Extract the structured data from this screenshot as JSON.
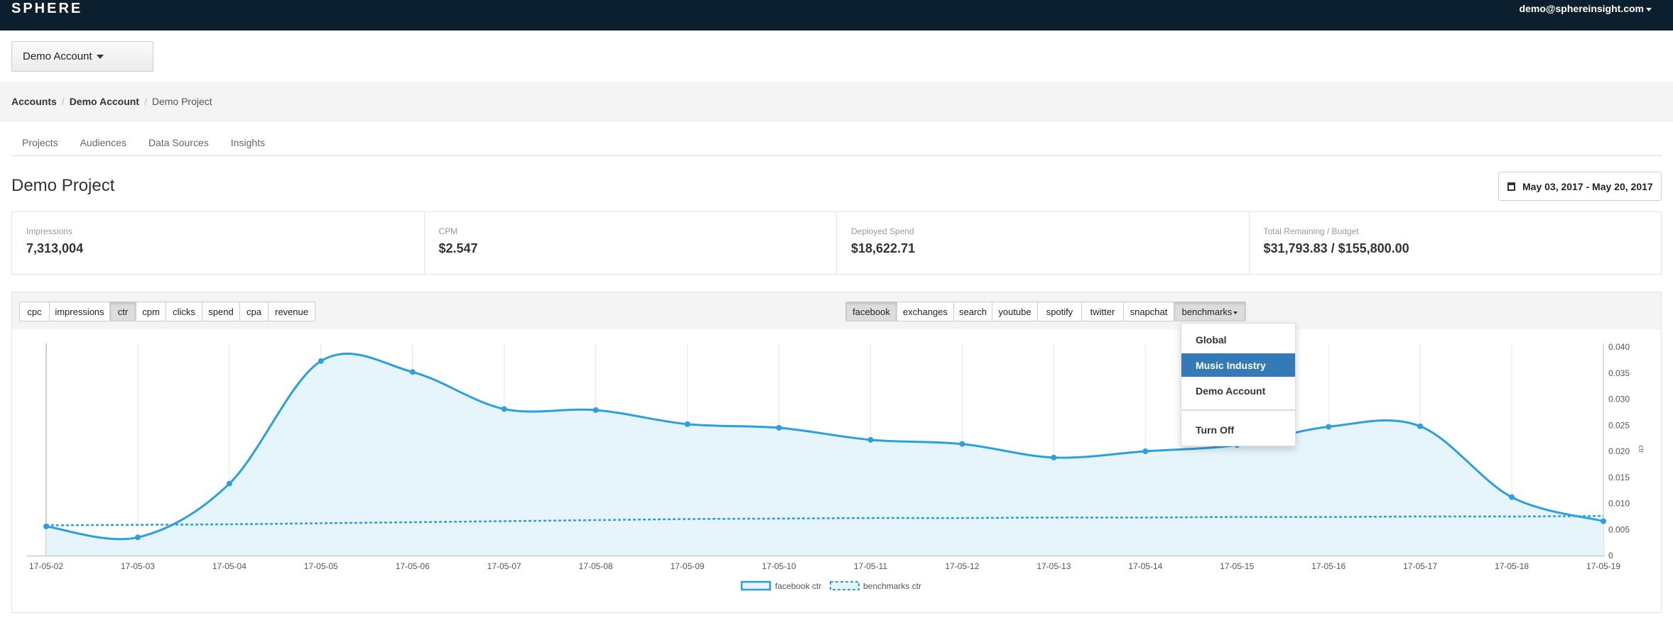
{
  "header": {
    "brand": "SPHERE",
    "user_email": "demo@sphereinsight.com"
  },
  "account": {
    "label": "Demo Account"
  },
  "breadcrumb": [
    "Accounts",
    "Demo Account",
    "Demo Project"
  ],
  "nav": [
    "Projects",
    "Audiences",
    "Data Sources",
    "Insights"
  ],
  "page": {
    "title": "Demo Project",
    "date_range": "May 03, 2017 - May 20, 2017"
  },
  "stats": [
    {
      "label": "Impressions",
      "value": "7,313,004"
    },
    {
      "label": "CPM",
      "value": "$2.547"
    },
    {
      "label": "Deployed Spend",
      "value": "$18,622.71"
    },
    {
      "label": "Total Remaining / Budget",
      "value": "$31,793.83 / $155,800.00"
    }
  ],
  "metrics": {
    "items": [
      "cpc",
      "impressions",
      "ctr",
      "cpm",
      "clicks",
      "spend",
      "cpa",
      "revenue"
    ],
    "active": "ctr"
  },
  "channels": {
    "items": [
      "facebook",
      "exchanges",
      "search",
      "youtube",
      "spotify",
      "twitter",
      "snapchat"
    ],
    "active": "facebook",
    "dropdown_label": "benchmarks"
  },
  "benchmark_menu": {
    "items": [
      "Global",
      "Music Industry",
      "Demo Account",
      "Turn Off"
    ],
    "selected": "Music Industry"
  },
  "colors": {
    "topbar": "#0c1f2e",
    "series": "#2b9fe0",
    "area": "#e6f4fc",
    "menu_selected": "#337ab7"
  },
  "chart_data": {
    "type": "area",
    "x": [
      "17-05-02",
      "17-05-03",
      "17-05-04",
      "17-05-05",
      "17-05-06",
      "17-05-07",
      "17-05-08",
      "17-05-09",
      "17-05-10",
      "17-05-11",
      "17-05-12",
      "17-05-13",
      "17-05-14",
      "17-05-15",
      "17-05-16",
      "17-05-17",
      "17-05-18",
      "17-05-19"
    ],
    "series": [
      {
        "name": "facebook ctr",
        "style": "solid-area",
        "values": [
          0.0056,
          0.0035,
          0.0138,
          0.0373,
          0.0352,
          0.0281,
          0.0279,
          0.0252,
          0.0245,
          0.0222,
          0.0214,
          0.0188,
          0.02,
          0.0212,
          0.0247,
          0.0248,
          0.0112,
          0.0066
        ]
      },
      {
        "name": "benchmarks ctr",
        "style": "dashed",
        "values": [
          0.0058,
          0.0059,
          0.006,
          0.0062,
          0.0064,
          0.0066,
          0.0068,
          0.007,
          0.0071,
          0.0072,
          0.0072,
          0.0073,
          0.0073,
          0.0074,
          0.0074,
          0.0075,
          0.0075,
          0.0076
        ]
      }
    ],
    "y_ticks": [
      "0",
      "0.005",
      "0.010",
      "0.015",
      "0.020",
      "0.025",
      "0.030",
      "0.035",
      "0.040"
    ],
    "ylim": [
      0,
      0.04
    ],
    "ylabel": "ctr",
    "y_axis_side": "right",
    "grid": "vertical",
    "legend": "bottom-center"
  }
}
